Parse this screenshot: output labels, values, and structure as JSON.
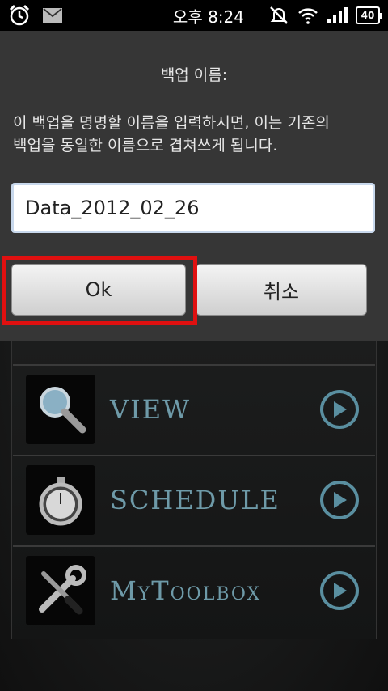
{
  "status_bar": {
    "time": "오후 8:24",
    "battery": "40",
    "icons": [
      "alarm-icon",
      "mail-icon",
      "mute-icon",
      "wifi-icon",
      "signal-icon",
      "battery-icon"
    ]
  },
  "dialog": {
    "title": "백업 이름:",
    "message": "이 백업을 명명할 이름을 입력하시면, 이는 기존의 백업을 동일한 이름으로 겹쳐쓰게 됩니다.",
    "input_value": "Data_2012_02_26",
    "ok_label": "Ok",
    "cancel_label": "취소"
  },
  "menu": {
    "items": [
      {
        "label": "VIEW",
        "icon": "magnifier-icon"
      },
      {
        "label": "SCHEDULE",
        "icon": "stopwatch-icon"
      },
      {
        "label": "MyToolbox",
        "icon": "tools-icon"
      }
    ]
  },
  "colors": {
    "accent": "#6e9aa8",
    "highlight": "#e01010",
    "dialog_bg": "#363636"
  }
}
